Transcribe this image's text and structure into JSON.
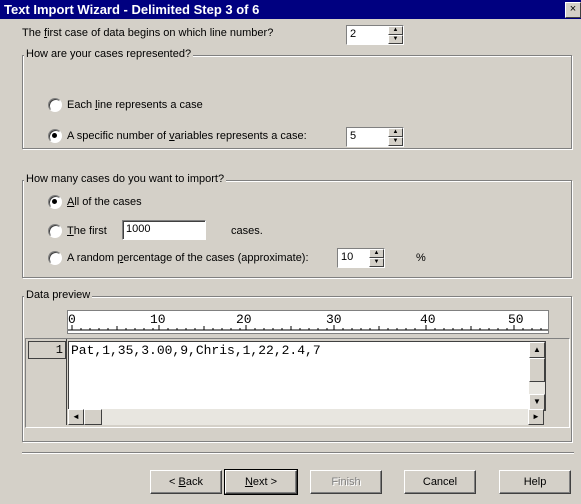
{
  "window": {
    "title": "Text Import Wizard - Delimited Step 3 of 6",
    "close_glyph": "×"
  },
  "first_line": {
    "label_pre": "The ",
    "label_u": "f",
    "label_post": "irst case of data begins on which line number?",
    "value": "2"
  },
  "cases_group": {
    "title": "How are your cases represented?",
    "option1_pre": "Each ",
    "option1_u": "l",
    "option1_post": "ine represents a case",
    "option2_pre": "A specific number of ",
    "option2_u": "v",
    "option2_post": "ariables represents a case:",
    "variables_value": "5",
    "selected": "option2"
  },
  "import_group": {
    "title": "How many cases do you want to import?",
    "all_u": "A",
    "all_post": "ll of the cases",
    "first_u": "T",
    "first_post": "he first",
    "first_value": "1000",
    "first_suffix": "cases.",
    "random_pre": "A random ",
    "random_u": "p",
    "random_post": "ercentage of the cases (approximate):",
    "random_value": "10",
    "percent": "%",
    "selected": "all"
  },
  "preview": {
    "title": "Data preview",
    "ruler": [
      "0",
      "10",
      "20",
      "30",
      "40",
      "50"
    ],
    "row_number": "1",
    "row_text": "Pat,1,35,3.00,9,Chris,1,22,2.4,7"
  },
  "buttons": {
    "back_pre": "< ",
    "back_u": "B",
    "back_post": "ack",
    "next_u": "N",
    "next_post": "ext >",
    "finish": "Finish",
    "cancel": "Cancel",
    "help": "Help"
  },
  "icons": {
    "spin_up": "▲",
    "spin_down": "▼",
    "scroll_up": "▲",
    "scroll_down": "▼",
    "scroll_left": "◄",
    "scroll_right": "►"
  }
}
